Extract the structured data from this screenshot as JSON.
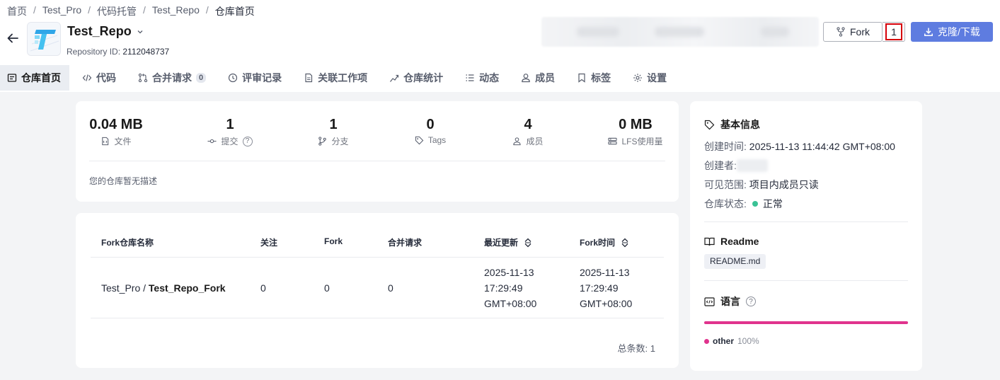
{
  "breadcrumb": {
    "items": [
      "首页",
      "Test_Pro",
      "代码托管",
      "Test_Repo",
      "仓库首页"
    ],
    "separator": "/"
  },
  "repo": {
    "name": "Test_Repo",
    "id_label": "Repository ID:",
    "id_value": "2112048737"
  },
  "actions": {
    "fork_label": "Fork",
    "fork_count": "1",
    "clone_label": "克隆/下载"
  },
  "tabs": [
    {
      "label": "仓库首页",
      "icon": "repo-home-icon",
      "active": true
    },
    {
      "label": "代码",
      "icon": "code-icon"
    },
    {
      "label": "合并请求",
      "icon": "merge-request-icon",
      "badge": "0"
    },
    {
      "label": "评审记录",
      "icon": "review-icon"
    },
    {
      "label": "关联工作项",
      "icon": "document-icon"
    },
    {
      "label": "仓库统计",
      "icon": "stats-icon"
    },
    {
      "label": "动态",
      "icon": "list-icon"
    },
    {
      "label": "成员",
      "icon": "user-icon"
    },
    {
      "label": "标签",
      "icon": "bookmark-icon"
    },
    {
      "label": "设置",
      "icon": "gear-icon"
    }
  ],
  "stats": [
    {
      "value": "0.04 MB",
      "label": "文件",
      "icon": "file-icon"
    },
    {
      "value": "1",
      "label": "提交",
      "icon": "commit-icon"
    },
    {
      "value": "1",
      "label": "分支",
      "icon": "branch-icon"
    },
    {
      "value": "0",
      "label": "Tags",
      "icon": "tag-icon"
    },
    {
      "value": "4",
      "label": "成员",
      "icon": "members-icon"
    },
    {
      "value": "0 MB",
      "label": "LFS使用量",
      "icon": "storage-icon"
    }
  ],
  "description": "您的仓库暂无描述",
  "fork_table": {
    "headers": [
      "Fork仓库名称",
      "关注",
      "Fork",
      "合并请求",
      "最近更新",
      "Fork时间"
    ],
    "rows": [
      {
        "project": "Test_Pro / ",
        "name": "Test_Repo_Fork",
        "watch": "0",
        "fork": "0",
        "merge": "0",
        "updated": [
          "2025-11-13",
          "17:29:49",
          "GMT+08:00"
        ],
        "forked": [
          "2025-11-13",
          "17:29:49",
          "GMT+08:00"
        ]
      }
    ],
    "total": "总条数: 1"
  },
  "side": {
    "basic_title": "基本信息",
    "created_time_label": "创建时间:",
    "created_time_value": "2025-11-13 11:44:42 GMT+08:00",
    "creator_label": "创建者:",
    "visibility_label": "可见范围:",
    "visibility_value": "项目内成员只读",
    "status_label": "仓库状态:",
    "status_value": "正常",
    "status_color": "#3ac295",
    "readme_title": "Readme",
    "readme_file": "README.md",
    "lang_title": "语言",
    "lang_name": "other",
    "lang_percent": "100%",
    "lang_color": "#e0338d"
  },
  "colors": {
    "primary": "#5e7ce0",
    "highlight_border": "#d6000a"
  }
}
